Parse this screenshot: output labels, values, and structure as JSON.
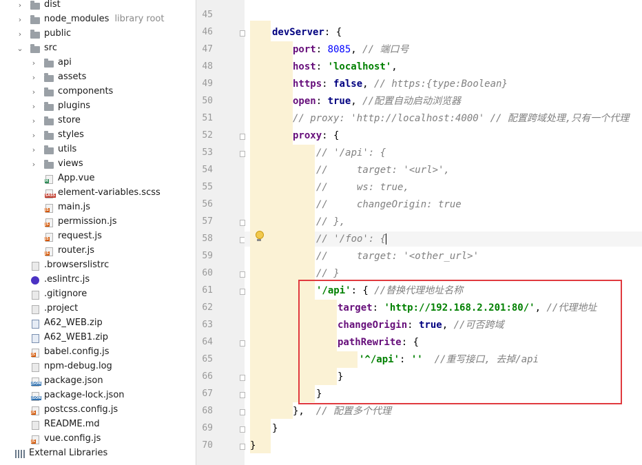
{
  "tree": {
    "items": [
      {
        "label": "dist",
        "type": "folder",
        "depth": 1,
        "arrow": "›"
      },
      {
        "label": "node_modules",
        "type": "folder",
        "depth": 1,
        "arrow": "›",
        "suffix": "library root"
      },
      {
        "label": "public",
        "type": "folder",
        "depth": 1,
        "arrow": "›"
      },
      {
        "label": "src",
        "type": "folder",
        "depth": 1,
        "arrow": "⌄"
      },
      {
        "label": "api",
        "type": "folder",
        "depth": 2,
        "arrow": "›"
      },
      {
        "label": "assets",
        "type": "folder",
        "depth": 2,
        "arrow": "›"
      },
      {
        "label": "components",
        "type": "folder",
        "depth": 2,
        "arrow": "›"
      },
      {
        "label": "plugins",
        "type": "folder",
        "depth": 2,
        "arrow": "›"
      },
      {
        "label": "store",
        "type": "folder",
        "depth": 2,
        "arrow": "›"
      },
      {
        "label": "styles",
        "type": "folder",
        "depth": 2,
        "arrow": "›"
      },
      {
        "label": "utils",
        "type": "folder",
        "depth": 2,
        "arrow": "›"
      },
      {
        "label": "views",
        "type": "folder",
        "depth": 2,
        "arrow": "›"
      },
      {
        "label": "App.vue",
        "type": "vue",
        "depth": 2,
        "tag": "H"
      },
      {
        "label": "element-variables.scss",
        "type": "sass",
        "depth": 2,
        "tag": "SASS"
      },
      {
        "label": "main.js",
        "type": "js",
        "depth": 2,
        "tag": "JS"
      },
      {
        "label": "permission.js",
        "type": "js",
        "depth": 2,
        "tag": "JS"
      },
      {
        "label": "request.js",
        "type": "js",
        "depth": 2,
        "tag": "JS"
      },
      {
        "label": "router.js",
        "type": "js",
        "depth": 2,
        "tag": "JS"
      },
      {
        "label": ".browserslistrc",
        "type": "plain",
        "depth": 1
      },
      {
        "label": ".eslintrc.js",
        "type": "eslint",
        "depth": 1
      },
      {
        "label": ".gitignore",
        "type": "plain",
        "depth": 1
      },
      {
        "label": ".project",
        "type": "plain",
        "depth": 1
      },
      {
        "label": "A62_WEB.zip",
        "type": "zip",
        "depth": 1
      },
      {
        "label": "A62_WEB1.zip",
        "type": "zip",
        "depth": 1
      },
      {
        "label": "babel.config.js",
        "type": "js",
        "depth": 1,
        "tag": "JS"
      },
      {
        "label": "npm-debug.log",
        "type": "plain",
        "depth": 1
      },
      {
        "label": "package.json",
        "type": "json",
        "depth": 1,
        "tag": "JSON"
      },
      {
        "label": "package-lock.json",
        "type": "json",
        "depth": 1,
        "tag": "JSON"
      },
      {
        "label": "postcss.config.js",
        "type": "js",
        "depth": 1,
        "tag": "JS"
      },
      {
        "label": "README.md",
        "type": "plain",
        "depth": 1
      },
      {
        "label": "vue.config.js",
        "type": "js",
        "depth": 1,
        "tag": "JS"
      },
      {
        "label": "External Libraries",
        "type": "libs",
        "depth": 0
      }
    ]
  },
  "editor": {
    "lines": [
      {
        "n": "45",
        "parts": []
      },
      {
        "n": "46",
        "parts": [
          [
            "k",
            "devServer"
          ],
          [
            "p",
            ": {"
          ]
        ]
      },
      {
        "n": "47",
        "parts": [
          [
            "pr",
            "port"
          ],
          [
            "p",
            ": "
          ],
          [
            "num",
            "8085"
          ],
          [
            "p",
            ", "
          ],
          [
            "cm",
            "// 端口号"
          ]
        ]
      },
      {
        "n": "48",
        "parts": [
          [
            "pr",
            "host"
          ],
          [
            "p",
            ": "
          ],
          [
            "str",
            "'localhost'"
          ],
          [
            "p",
            ","
          ]
        ]
      },
      {
        "n": "49",
        "parts": [
          [
            "pr",
            "https"
          ],
          [
            "p",
            ": "
          ],
          [
            "k",
            "false"
          ],
          [
            "p",
            ", "
          ],
          [
            "cm",
            "// https:{type:Boolean}"
          ]
        ]
      },
      {
        "n": "50",
        "parts": [
          [
            "pr",
            "open"
          ],
          [
            "p",
            ": "
          ],
          [
            "k",
            "true"
          ],
          [
            "p",
            ", "
          ],
          [
            "cm",
            "//配置自动启动浏览器"
          ]
        ]
      },
      {
        "n": "51",
        "parts": [
          [
            "cm",
            "// proxy: 'http://localhost:4000' // 配置跨域处理,只有一个代理"
          ]
        ]
      },
      {
        "n": "52",
        "parts": [
          [
            "pr",
            "proxy"
          ],
          [
            "p",
            ": {"
          ]
        ]
      },
      {
        "n": "53",
        "parts": [
          [
            "cm",
            "// '/api': {"
          ]
        ]
      },
      {
        "n": "54",
        "parts": [
          [
            "cm",
            "//     target: '<url>',"
          ]
        ]
      },
      {
        "n": "55",
        "parts": [
          [
            "cm",
            "//     ws: true,"
          ]
        ]
      },
      {
        "n": "56",
        "parts": [
          [
            "cm",
            "//     changeOrigin: true"
          ]
        ]
      },
      {
        "n": "57",
        "parts": [
          [
            "cm",
            "// },"
          ]
        ]
      },
      {
        "n": "58",
        "parts": [
          [
            "cm",
            "// '/foo': {"
          ]
        ]
      },
      {
        "n": "59",
        "parts": [
          [
            "cm",
            "//     target: '<other_url>'"
          ]
        ]
      },
      {
        "n": "60",
        "parts": [
          [
            "cm",
            "// }"
          ]
        ]
      },
      {
        "n": "61",
        "parts": [
          [
            "str",
            "'/api'"
          ],
          [
            "p",
            ": { "
          ],
          [
            "cm",
            "//替换代理地址名称"
          ]
        ]
      },
      {
        "n": "62",
        "parts": [
          [
            "pr",
            "target"
          ],
          [
            "p",
            ": "
          ],
          [
            "str",
            "'http://192.168.2.201:80/'"
          ],
          [
            "p",
            ", "
          ],
          [
            "cm",
            "//代理地址"
          ]
        ]
      },
      {
        "n": "63",
        "parts": [
          [
            "pr",
            "changeOrigin"
          ],
          [
            "p",
            ": "
          ],
          [
            "k",
            "true"
          ],
          [
            "p",
            ", "
          ],
          [
            "cm",
            "//可否跨域"
          ]
        ]
      },
      {
        "n": "64",
        "parts": [
          [
            "pr",
            "pathRewrite"
          ],
          [
            "p",
            ": {"
          ]
        ]
      },
      {
        "n": "65",
        "parts": [
          [
            "str",
            "'^/api'"
          ],
          [
            "p",
            ": "
          ],
          [
            "str",
            "''"
          ],
          [
            "p",
            "  "
          ],
          [
            "cm",
            "//重写接口, 去掉/api"
          ]
        ]
      },
      {
        "n": "66",
        "parts": [
          [
            "p",
            "}"
          ]
        ]
      },
      {
        "n": "67",
        "parts": [
          [
            "p",
            "}"
          ]
        ]
      },
      {
        "n": "68",
        "parts": [
          [
            "p",
            "},  "
          ],
          [
            "cm",
            "// 配置多个代理"
          ]
        ]
      },
      {
        "n": "69",
        "parts": [
          [
            "p",
            "}"
          ]
        ]
      },
      {
        "n": "70",
        "parts": [
          [
            "p",
            "}"
          ]
        ]
      }
    ]
  },
  "colors": {
    "highlight_box": "#e0393e",
    "indent_guide": "#fbf2d5"
  }
}
